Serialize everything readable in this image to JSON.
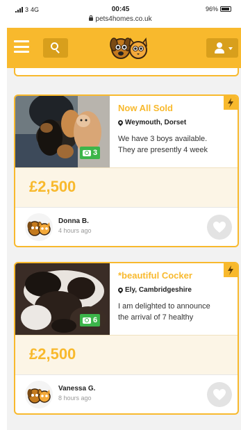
{
  "status_bar": {
    "carrier": "3",
    "network": "4G",
    "time": "00:45",
    "battery": "96%",
    "url": "pets4homes.co.uk"
  },
  "header": {
    "menu_icon": "hamburger-menu-icon",
    "search_icon": "search-icon",
    "logo_icon": "pets4homes-logo-icon",
    "account_icon": "user-icon"
  },
  "listings": [
    {
      "title": "Now All Sold",
      "location": "Weymouth, Dorset",
      "description_line1": "We have 3 boys available.",
      "description_line2": "They are presently 4 week",
      "photo_count": "3",
      "price": "£2,500",
      "seller_name": "Donna B.",
      "seller_time": "4 hours ago"
    },
    {
      "title": "*beautiful Cocker",
      "location": "Ely, Cambridgeshire",
      "description_line1": "I am delighted to announce",
      "description_line2": "the arrival of 7 healthy",
      "photo_count": "6",
      "price": "£2,500",
      "seller_name": "Vanessa G.",
      "seller_time": "8 hours ago"
    }
  ],
  "colors": {
    "brand": "#f8b92d",
    "brand_dark": "#d89f1c",
    "photo_badge": "#3cb54a",
    "price_background": "#fcf5e6"
  }
}
